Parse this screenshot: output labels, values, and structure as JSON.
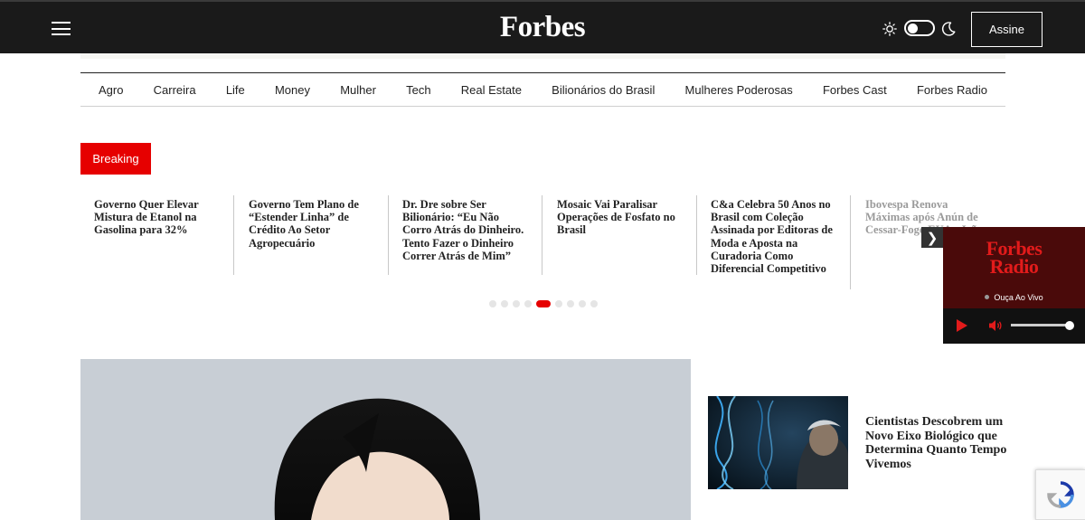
{
  "header": {
    "logo": "Forbes",
    "subscribe_label": "Assine",
    "background": "#1a1a1a"
  },
  "nav": {
    "items": [
      "Agro",
      "Carreira",
      "Life",
      "Money",
      "Mulher",
      "Tech",
      "Real Estate",
      "Bilionários do Brasil",
      "Mulheres Poderosas",
      "Forbes Cast",
      "Forbes Radio"
    ]
  },
  "breaking": {
    "label": "Breaking",
    "accent": "#e60000",
    "headlines": [
      "Governo Quer Elevar Mistura de Etanol na Gasolina para 32%",
      "Governo Tem Plano de “Estender Linha” de Crédito Ao Setor Agropecuário",
      "Dr. Dre sobre Ser Bilionário: “Eu Não Corro Atrás do Dinheiro. Tento Fazer o Dinheiro Correr Atrás de Mim”",
      "Mosaic Vai Paralisar Operações de Fosfato no Brasil",
      "C&a Celebra 50 Anos no Brasil com Coleção Assinada por Editoras de Moda e Aposta na Curadoria Como Diferencial Competitivo",
      "Ibovespa Renova Máximas após Anún de Cessar-Fogo EUA e Irã"
    ],
    "carousel_dots": 9,
    "active_dot": 4
  },
  "radio": {
    "logo_line1": "Forbes",
    "logo_line2": "Radio",
    "live_label": "Ouça Ao Vivo",
    "volume": 0.97
  },
  "featured": {
    "side_article_title": "Cientistas Descobrem um Novo Eixo Biológico que Determina Quanto Tempo Vivemos"
  }
}
